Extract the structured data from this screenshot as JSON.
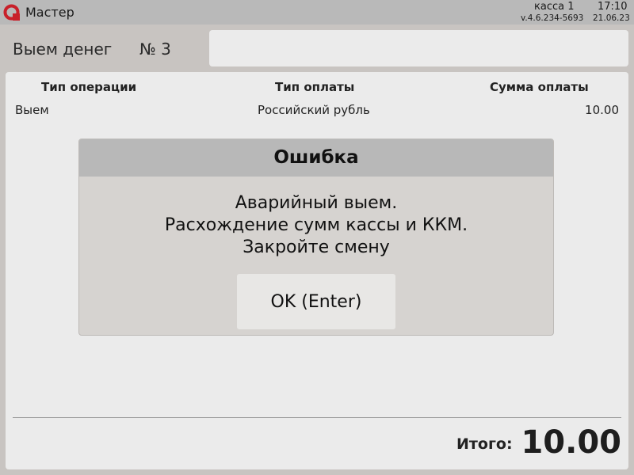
{
  "topbar": {
    "app_title": "Мастер",
    "register_name": "касса 1",
    "time": "17:10",
    "version": "v.4.6.234-5693",
    "date": "21.06.23",
    "logo_icon": "brand-logo-icon",
    "logo_color": "#c8202a"
  },
  "document": {
    "title": "Выем денег",
    "number": "№ 3"
  },
  "table": {
    "columns": [
      "Тип операции",
      "Тип оплаты",
      "Сумма оплаты"
    ],
    "rows": [
      [
        "Выем",
        "Российский рубль",
        "10.00"
      ]
    ]
  },
  "totals": {
    "label": "Итого:",
    "value": "10.00"
  },
  "dialog": {
    "title": "Ошибка",
    "message_lines": [
      "Аварийный выем.",
      "Расхождение сумм кассы и ККМ.",
      "Закройте смену"
    ],
    "ok_label": "OK (Enter)"
  }
}
